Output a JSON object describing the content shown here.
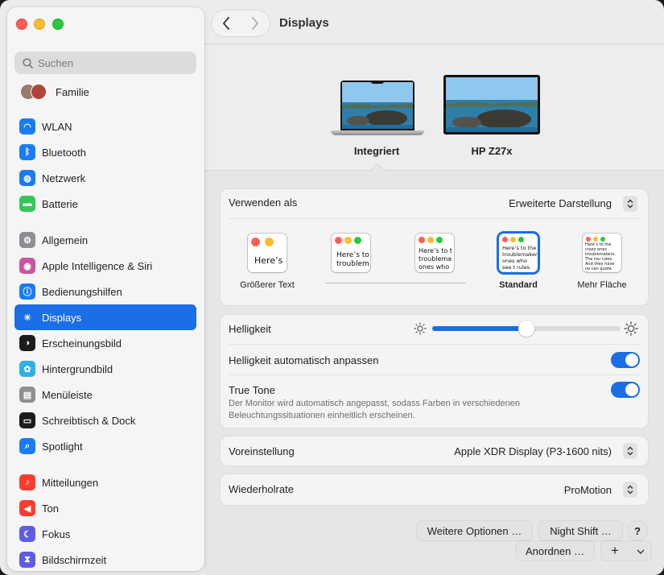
{
  "window": {
    "title": "Displays"
  },
  "sidebar": {
    "search_placeholder": "Suchen",
    "family_label": "Familie",
    "items": [
      {
        "label": "WLAN",
        "icon": "wifi-icon",
        "color": "#1a7cf5"
      },
      {
        "label": "Bluetooth",
        "icon": "bluetooth-icon",
        "color": "#1a7cf5"
      },
      {
        "label": "Netzwerk",
        "icon": "globe-icon",
        "color": "#1a7cf5"
      },
      {
        "label": "Batterie",
        "icon": "battery-icon",
        "color": "#34c759"
      },
      {
        "label": "Allgemein",
        "icon": "gear-icon",
        "color": "#8e8e93"
      },
      {
        "label": "Apple Intelligence & Siri",
        "icon": "siri-icon",
        "color": "#c9569f"
      },
      {
        "label": "Bedienungshilfen",
        "icon": "accessibility-icon",
        "color": "#1a7cf5"
      },
      {
        "label": "Displays",
        "icon": "sun-icon",
        "color": "#1a7cf5"
      },
      {
        "label": "Erscheinungsbild",
        "icon": "appearance-icon",
        "color": "#1c1c1e"
      },
      {
        "label": "Hintergrundbild",
        "icon": "flower-icon",
        "color": "#30b0e6"
      },
      {
        "label": "Menüleiste",
        "icon": "menubar-icon",
        "color": "#8e8e93"
      },
      {
        "label": "Schreibtisch & Dock",
        "icon": "dock-icon",
        "color": "#1c1c1e"
      },
      {
        "label": "Spotlight",
        "icon": "spotlight-icon",
        "color": "#1a7cf5"
      },
      {
        "label": "Mitteilungen",
        "icon": "bell-icon",
        "color": "#ff3b30"
      },
      {
        "label": "Ton",
        "icon": "speaker-icon",
        "color": "#ff3b30"
      },
      {
        "label": "Fokus",
        "icon": "moon-icon",
        "color": "#5e5ce6"
      },
      {
        "label": "Bildschirmzeit",
        "icon": "hourglass-icon",
        "color": "#5e5ce6"
      }
    ],
    "selected": "Displays"
  },
  "displays": {
    "monitors": [
      {
        "name": "Integriert",
        "selected": true
      },
      {
        "name": "HP Z27x",
        "selected": false
      }
    ]
  },
  "settings": {
    "use_as": {
      "label": "Verwenden als",
      "value": "Erweiterte Darstellung"
    },
    "scale_options": [
      {
        "label": "Größerer Text",
        "sample": "Here’s"
      },
      {
        "label": "",
        "sample": "Here’s to troublem"
      },
      {
        "label": "",
        "sample": "Here’s to t troublema ones who"
      },
      {
        "label": "Standard",
        "sample": "Here’s to the troublemakers, ones who see t rules. And they",
        "selected": true
      },
      {
        "label": "Mehr Fläche",
        "sample": "Here’s to the crazy ones troublemakers. The rou rules. And they have no can quote them, disagre them. About the only thi Because they change th"
      }
    ],
    "brightness": {
      "label": "Helligkeit",
      "level": 0.5
    },
    "auto_brightness": {
      "label": "Helligkeit automatisch anpassen",
      "on": true
    },
    "true_tone": {
      "label": "True Tone",
      "on": true,
      "description_line1": "Der Monitor wird automatisch angepasst, sodass Farben in verschiedenen",
      "description_line2": "Beleuchtungssituationen einheitlich erscheinen."
    },
    "preset": {
      "label": "Voreinstellung",
      "value": "Apple XDR Display (P3-1600 nits)"
    },
    "refresh": {
      "label": "Wiederholrate",
      "value": "ProMotion"
    }
  },
  "buttons": {
    "more_options": "Weitere Optionen …",
    "night_shift": "Night Shift …",
    "help": "?",
    "arrange": "Anordnen …",
    "add": "+"
  },
  "colors": {
    "accent": "#1a6ee6"
  }
}
